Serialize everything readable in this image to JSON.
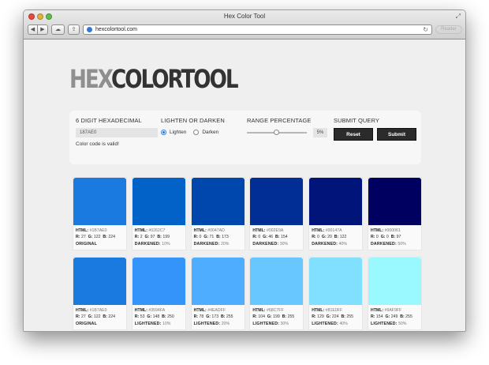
{
  "window": {
    "title": "Hex Color Tool",
    "url": "hexcolortool.com",
    "reader": "Reader"
  },
  "logo": {
    "part1": "HEX",
    "part2": "COLOR",
    "part3": "TOOL"
  },
  "form": {
    "hex_label": "6 DIGIT HEXADECIMAL",
    "hex_value": "187AE0",
    "valid_msg": "Color code is valid!",
    "mode_label": "LIGHTEN OR DARKEN",
    "lighten": "Lighten",
    "darken": "Darken",
    "selected_mode": "Lighten",
    "range_label": "RANGE PERCENTAGE",
    "range_value": "5%",
    "range_fraction": 0.5,
    "submit_label": "SUBMIT QUERY",
    "reset_button": "Reset",
    "submit_button": "Submit"
  },
  "labels": {
    "html": "HTML:",
    "r": "R:",
    "g": "G:",
    "b": "B:"
  },
  "dark_row": [
    {
      "hex": "#1B7AE0",
      "r": "27",
      "g": "122",
      "b": "224",
      "caption": "ORIGINAL",
      "pct": "",
      "color": "#1b7ae0"
    },
    {
      "hex": "#0262C7",
      "r": "2",
      "g": "97",
      "b": "199",
      "caption": "DARKENED:",
      "pct": "10%",
      "color": "#0262c7"
    },
    {
      "hex": "#0047AD",
      "r": "0",
      "g": "71",
      "b": "173",
      "caption": "DARKENED:",
      "pct": "20%",
      "color": "#0047ad"
    },
    {
      "hex": "#002E9A",
      "r": "0",
      "g": "46",
      "b": "154",
      "caption": "DARKENED:",
      "pct": "30%",
      "color": "#002e94"
    },
    {
      "hex": "#00147A",
      "r": "0",
      "g": "20",
      "b": "122",
      "caption": "DARKENED:",
      "pct": "40%",
      "color": "#00147a"
    },
    {
      "hex": "#000061",
      "r": "0",
      "g": "0",
      "b": "97",
      "caption": "DARKENED:",
      "pct": "50%",
      "color": "#000061"
    }
  ],
  "light_row": [
    {
      "hex": "#1B7AE0",
      "r": "27",
      "g": "122",
      "b": "224",
      "caption": "ORIGINAL",
      "pct": "",
      "color": "#1b7ae0"
    },
    {
      "hex": "#3594FA",
      "r": "53",
      "g": "148",
      "b": "250",
      "caption": "LIGHTENED:",
      "pct": "10%",
      "color": "#3594fa"
    },
    {
      "hex": "#4EADFF",
      "r": "78",
      "g": "173",
      "b": "255",
      "caption": "LIGHTENED:",
      "pct": "20%",
      "color": "#4eadff"
    },
    {
      "hex": "#68C7FF",
      "r": "104",
      "g": "199",
      "b": "255",
      "caption": "LIGHTENED:",
      "pct": "30%",
      "color": "#68c7ff"
    },
    {
      "hex": "#81E0FF",
      "r": "129",
      "g": "224",
      "b": "255",
      "caption": "LIGHTENED:",
      "pct": "40%",
      "color": "#81e0ff"
    },
    {
      "hex": "#9AF9FF",
      "r": "154",
      "g": "249",
      "b": "255",
      "caption": "LIGHTENED:",
      "pct": "50%",
      "color": "#9af9ff"
    }
  ]
}
